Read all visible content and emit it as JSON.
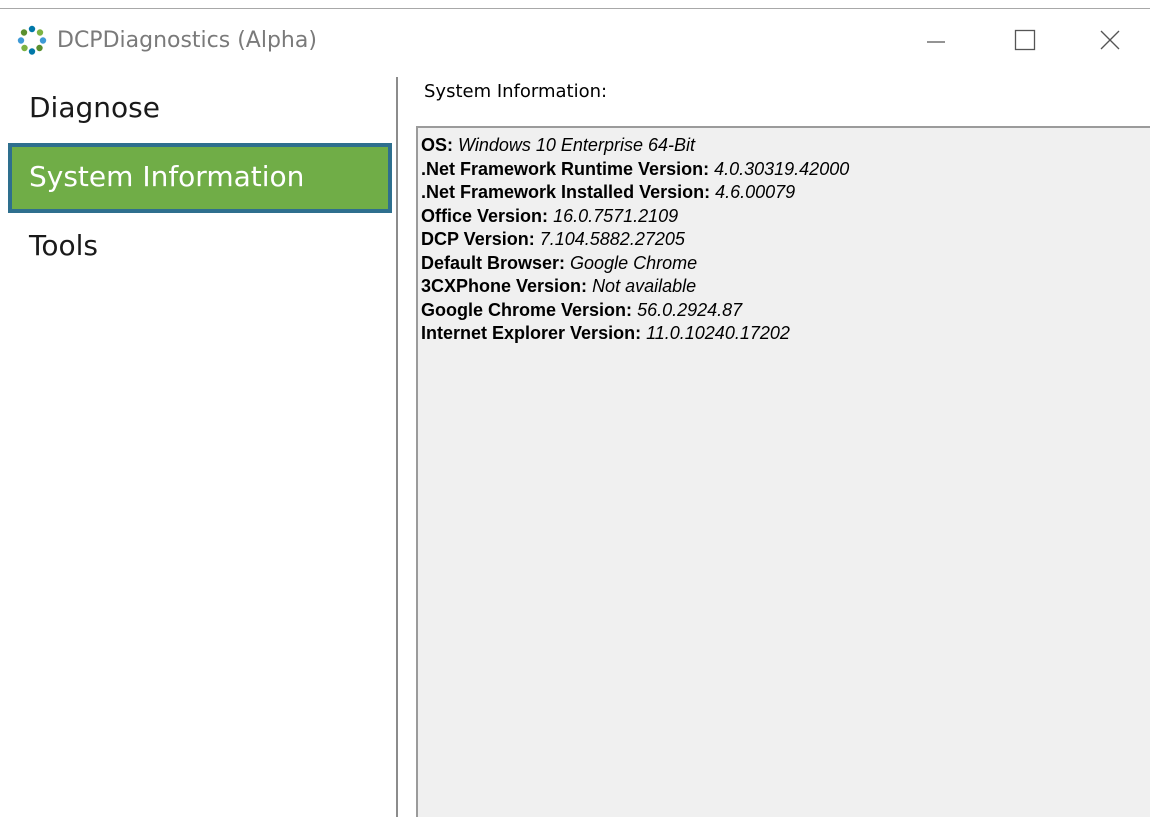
{
  "window": {
    "title": "DCPDiagnostics (Alpha)",
    "icon": "app-logo-icon",
    "controls": [
      "minimize-icon",
      "maximize-icon",
      "close-icon"
    ]
  },
  "sidebar": {
    "items": [
      {
        "label": "Diagnose",
        "selected": false
      },
      {
        "label": "System Information",
        "selected": true
      },
      {
        "label": "Tools",
        "selected": false
      }
    ]
  },
  "main": {
    "section_label": "System Information:",
    "info": [
      {
        "key": "OS:",
        "value": "Windows 10 Enterprise 64-Bit"
      },
      {
        "key": ".Net Framework Runtime Version:",
        "value": "4.0.30319.42000"
      },
      {
        "key": ".Net Framework Installed Version:",
        "value": "4.6.00079"
      },
      {
        "key": "Office Version:",
        "value": "16.0.7571.2109"
      },
      {
        "key": "DCP Version:",
        "value": "7.104.5882.27205"
      },
      {
        "key": "Default Browser:",
        "value": "Google Chrome"
      },
      {
        "key": "3CXPhone Version:",
        "value": "Not available"
      },
      {
        "key": "Google Chrome Version:",
        "value": "56.0.2924.87"
      },
      {
        "key": "Internet Explorer Version:",
        "value": "11.0.10240.17202"
      }
    ]
  },
  "colors": {
    "selected_bg": "#70ad47",
    "selected_border": "#2e6f8e",
    "selected_text": "#ffffff",
    "info_bg": "#f0f0f0",
    "title_text": "#7a7a7a"
  }
}
